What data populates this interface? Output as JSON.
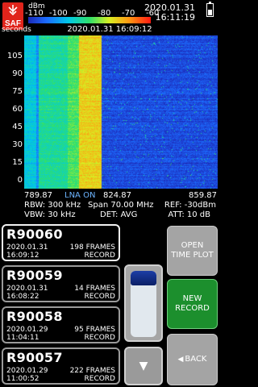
{
  "header": {
    "logo_text": "SAF",
    "unit": "dBm",
    "scale_labels": [
      "-110",
      "-100",
      "-90",
      "-80",
      "-70",
      "-60"
    ],
    "date": "2020.01.31",
    "time": "16:11:19",
    "battery_level": 0.55
  },
  "waterfall": {
    "axis_unit": "seconds",
    "timestamp": "2020.01.31 16:09:12",
    "y_ticks": [
      "105",
      "90",
      "75",
      "60",
      "45",
      "30",
      "15",
      "0"
    ]
  },
  "chart_data": {
    "type": "heatmap",
    "x_start_mhz": 789.87,
    "x_center_mhz": 824.87,
    "x_end_mhz": 859.87,
    "ylim": [
      0,
      110
    ],
    "color_scale_dbm": [
      -110,
      -60
    ],
    "bands": [
      {
        "from_mhz": 789.87,
        "to_mhz": 794.2,
        "level_dbm": -93
      },
      {
        "from_mhz": 794.2,
        "to_mhz": 795.0,
        "level_dbm": -99
      },
      {
        "from_mhz": 795.0,
        "to_mhz": 805.5,
        "level_dbm": -88
      },
      {
        "from_mhz": 805.5,
        "to_mhz": 809.5,
        "level_dbm": -84
      },
      {
        "from_mhz": 809.5,
        "to_mhz": 817.7,
        "level_dbm": -74
      },
      {
        "from_mhz": 817.7,
        "to_mhz": 859.87,
        "level_dbm": -106
      }
    ]
  },
  "freq_axis": {
    "start": "789.87",
    "mode": "LNA ON",
    "center": "824.87",
    "end": "859.87"
  },
  "settings": {
    "rbw": "RBW: 300 kHz",
    "span": "Span 70.00 MHz",
    "ref": "REF: -30dBm",
    "vbw": "VBW: 30 kHz",
    "det": "DET: AVG",
    "att": "ATT: 10 dB"
  },
  "recordings": [
    {
      "name": "R90060",
      "date": "2020.01.31",
      "time": "16:09:12",
      "frames": "198 FRAMES",
      "kind": "RECORD"
    },
    {
      "name": "R90059",
      "date": "2020.01.31",
      "time": "16:08:22",
      "frames": "14 FRAMES",
      "kind": "RECORD"
    },
    {
      "name": "R90058",
      "date": "2020.01.29",
      "time": "11:04:11",
      "frames": "95 FRAMES",
      "kind": "RECORD"
    },
    {
      "name": "R90057",
      "date": "2020.01.29",
      "time": "11:00:52",
      "frames": "222 FRAMES",
      "kind": "RECORD"
    }
  ],
  "buttons": {
    "open_time_plot": "OPEN\nTIME PLOT",
    "new_record": "NEW\nRECORD",
    "back": "BACK",
    "back_icon": "left-triangle-icon",
    "scroll_down_icon": "down-triangle-icon"
  },
  "colors": {
    "record_button": "#1c8f2d",
    "gray_button": "#a4a4a4",
    "highlight_text": "#6cb4ff",
    "logo_red": "#e0241b"
  }
}
